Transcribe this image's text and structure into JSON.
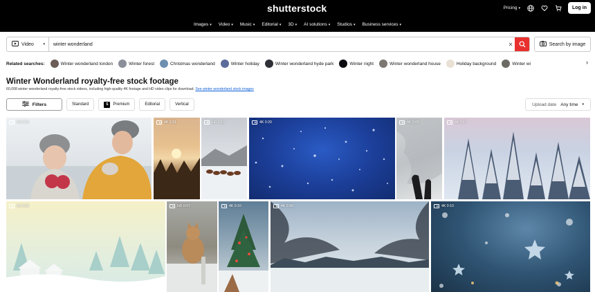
{
  "brand": {
    "logo": "shutterstock"
  },
  "nav": [
    {
      "label": "Images"
    },
    {
      "label": "Video"
    },
    {
      "label": "Music"
    },
    {
      "label": "Editorial"
    },
    {
      "label": "3D"
    },
    {
      "label": "AI solutions"
    },
    {
      "label": "Studios"
    },
    {
      "label": "Business services"
    }
  ],
  "header_right": {
    "pricing": "Pricing",
    "login": "Log in"
  },
  "search": {
    "media_type": "Video",
    "query": "winter wonderland",
    "search_by_image": "Search by image"
  },
  "related": {
    "label": "Related searches:",
    "items": [
      {
        "label": "Winter wonderland london",
        "color": "#6b5d55"
      },
      {
        "label": "Winter forest",
        "color": "#8a8f99"
      },
      {
        "label": "Christmas wonderland",
        "color": "#6f8fb0"
      },
      {
        "label": "Winter holiday",
        "color": "#5c6c9a"
      },
      {
        "label": "Winter wonderland hyde park",
        "color": "#2f2f38"
      },
      {
        "label": "Winter night",
        "color": "#0b0b0f"
      },
      {
        "label": "Winter wonderland house",
        "color": "#7d7772"
      },
      {
        "label": "Holiday background",
        "color": "#e9e2d4"
      },
      {
        "label": "Winter wi",
        "color": "#6b6a63"
      }
    ]
  },
  "results": {
    "title": "Winter Wonderland royalty-free stock footage",
    "subtitle": "60,008 winter wonderland royalty-free stock videos, including high-quality 4K footage and HD video clips for download.",
    "subtitle_link": "See winter wonderland stock images"
  },
  "filters": {
    "filters_label": "Filters",
    "pills": [
      {
        "label": "Standard",
        "badge": ""
      },
      {
        "label": "Premium",
        "badge": "S"
      },
      {
        "label": "Editorial",
        "badge": ""
      },
      {
        "label": "Vertical",
        "badge": ""
      }
    ],
    "upload_label": "Upload date",
    "upload_value": "Any time"
  },
  "tiles": [
    {
      "badge": "4K 0:14",
      "scene": "couple"
    },
    {
      "badge": "4K 0:21",
      "scene": "sunset"
    },
    {
      "badge": "HD 0:19",
      "scene": "reindeer"
    },
    {
      "badge": "4K 0:20",
      "scene": "snowblue"
    },
    {
      "badge": "4K 0:09",
      "scene": "feet"
    },
    {
      "badge": "4K 0:17",
      "scene": "forest"
    },
    {
      "badge": "4K 0:20",
      "scene": "cartoon"
    },
    {
      "badge": "HD 0:07",
      "scene": "cat"
    },
    {
      "badge": "4K 0:10",
      "scene": "christmas"
    },
    {
      "badge": "4K 0:30",
      "scene": "lake"
    },
    {
      "badge": "4K 0:10",
      "scene": "stars"
    }
  ]
}
